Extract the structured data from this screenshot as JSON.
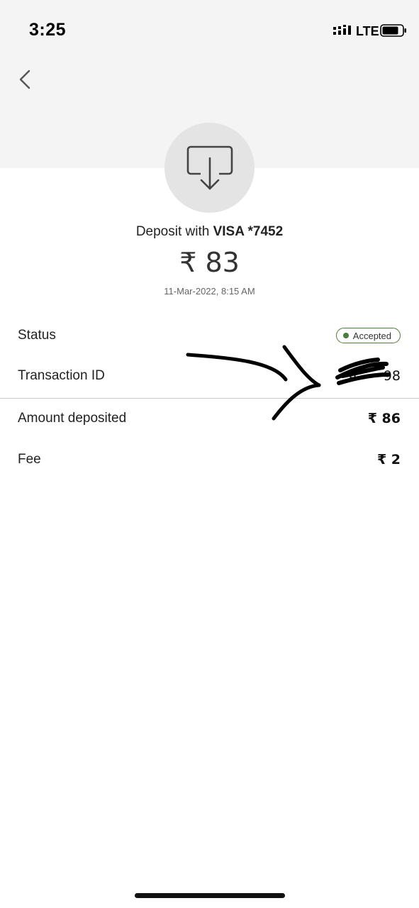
{
  "status_bar": {
    "time": "3:25",
    "network": "LTE"
  },
  "header": {
    "back_icon": "chevron-left-icon",
    "deposit_icon": "download-tray-icon"
  },
  "deposit": {
    "prefix": "Deposit with ",
    "card": "VISA *7452",
    "amount": "₹ 83",
    "datetime": "11-Mar-2022, 8:15 AM"
  },
  "details": {
    "status_label": "Status",
    "status_value": "Accepted",
    "transaction_label": "Transaction ID",
    "transaction_value": "4      98",
    "amount_deposited_label": "Amount deposited",
    "amount_deposited_value": "₹ 86",
    "fee_label": "Fee",
    "fee_value": "₹ 2"
  },
  "colors": {
    "accent_green": "#4a7c3a",
    "header_bg": "#f4f4f4",
    "icon_circle": "#e4e4e4"
  }
}
